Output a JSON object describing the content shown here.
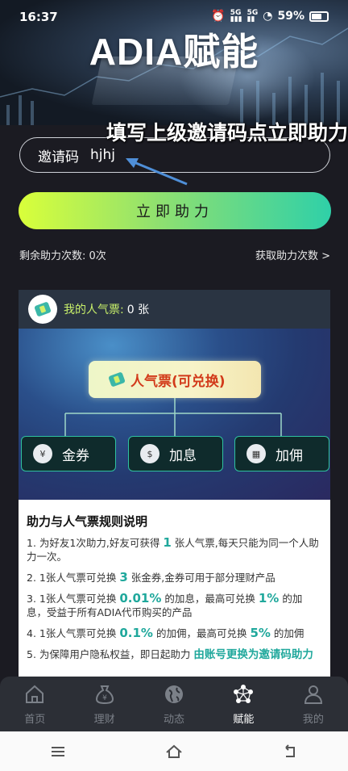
{
  "status_bar": {
    "time": "16:37",
    "battery": "59%"
  },
  "brand": {
    "title": "ADIA赋能"
  },
  "overlay_hint": {
    "text": "填写上级邀请码点立即助力"
  },
  "invite": {
    "label": "邀请码",
    "value": "hjhj"
  },
  "assist_button": {
    "label": "立即助力"
  },
  "counts": {
    "remaining": "剩余助力次数: 0次",
    "get_more": "获取助力次数 >"
  },
  "ticket_card": {
    "header_label": "我的人气票:",
    "header_value": "0 张",
    "main_label": "人气票(可兑换)",
    "options": [
      {
        "label": "金券",
        "icon": "coupon-icon"
      },
      {
        "label": "加息",
        "icon": "interest-icon"
      },
      {
        "label": "加佣",
        "icon": "commission-icon"
      }
    ]
  },
  "rules": {
    "title": "助力与人气票规则说明",
    "r1_a": "1. 为好友1次助力,好友可获得",
    "r1_hl": "1",
    "r1_b": "张人气票,每天只能为同一个人助力一次。",
    "r2_a": "2. 1张人气票可兑换",
    "r2_hl": "3",
    "r2_b": "张金券,金券可用于部分理财产品",
    "r3_a": "3. 1张人气票可兑换",
    "r3_hl": "0.01%",
    "r3_b": "的加息，最高可兑换",
    "r3_hl2": "1%",
    "r3_c": "的加息，受益于所有ADIA代币购买的产品",
    "r4_a": "4. 1张人气票可兑换",
    "r4_hl": "0.1%",
    "r4_b": "的加佣，最高可兑换",
    "r4_hl2": "5%",
    "r4_c": "的加佣",
    "r5_a": "5. 为保障用户隐私权益，即日起助力",
    "r5_hl": "由账号更换为邀请码助力"
  },
  "tabs": [
    {
      "label": "首页",
      "icon": "home-icon"
    },
    {
      "label": "理财",
      "icon": "money-bag-icon"
    },
    {
      "label": "动态",
      "icon": "globe-icon"
    },
    {
      "label": "赋能",
      "icon": "network-icon"
    },
    {
      "label": "我的",
      "icon": "user-icon"
    }
  ],
  "active_tab": "赋能",
  "colors": {
    "accent": "#20a89c",
    "gradient_start": "#d9ff3a",
    "gradient_end": "#2fd0a8",
    "highlight_red": "#d23a1a"
  }
}
